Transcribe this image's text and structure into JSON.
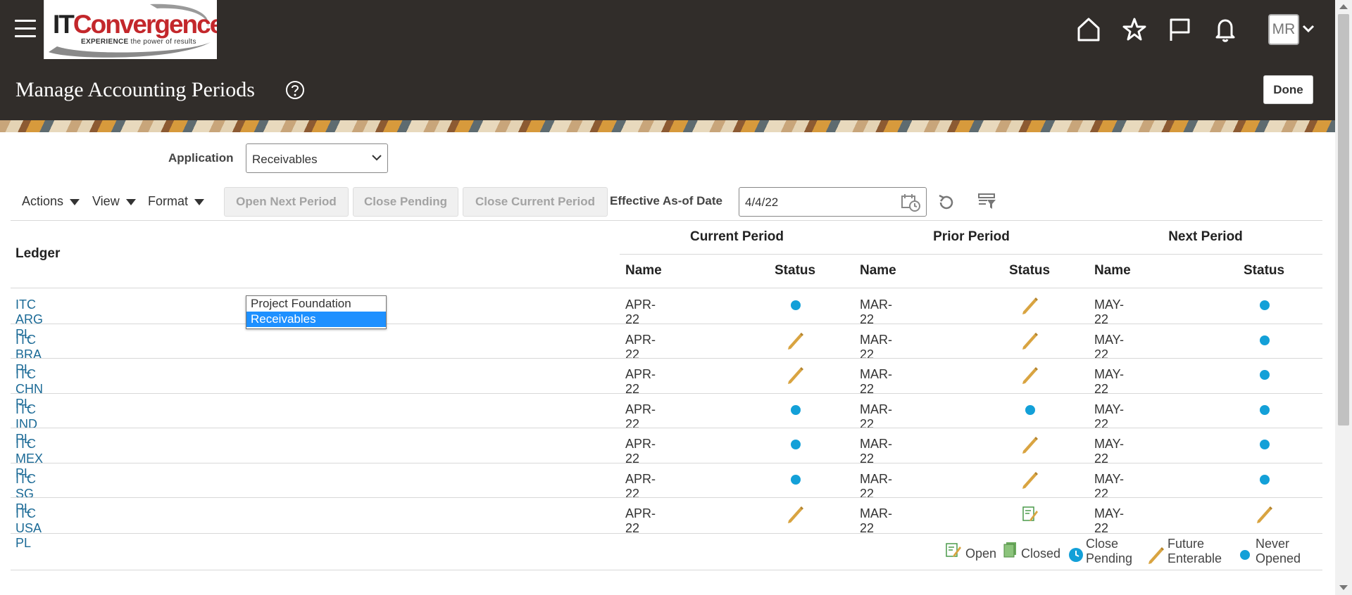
{
  "header": {
    "logo_main_it": "IT",
    "logo_main_conv": "Convergence",
    "logo_sub_bold": "EXPERIENCE",
    "logo_sub_rest": " the power of results",
    "avatar_initials": "MR",
    "icons": [
      "home-icon",
      "star-icon",
      "flag-icon",
      "bell-icon"
    ]
  },
  "page": {
    "title": "Manage Accounting Periods",
    "done_label": "Done"
  },
  "filters": {
    "application_label": "Application",
    "application_value": "Receivables",
    "application_options": [
      "Project Foundation",
      "Receivables"
    ]
  },
  "toolbar": {
    "actions_label": "Actions",
    "view_label": "View",
    "format_label": "Format",
    "open_next_period": "Open Next Period",
    "close_pending": "Close Pending",
    "close_current_period": "Close Current Period",
    "effective_date_label": "Effective As-of Date",
    "effective_date_value": "4/4/22"
  },
  "table": {
    "ledger_header": "Ledger",
    "groups": [
      "Current Period",
      "Prior Period",
      "Next Period"
    ],
    "name_header": "Name",
    "status_header": "Status",
    "rows": [
      {
        "ledger": "ITC ARG PL",
        "current_name": "APR-22",
        "current_status": "never_opened",
        "prior_name": "MAR-22",
        "prior_status": "future_enterable",
        "next_name": "MAY-22",
        "next_status": "never_opened"
      },
      {
        "ledger": "ITC BRA PL",
        "current_name": "APR-22",
        "current_status": "future_enterable",
        "prior_name": "MAR-22",
        "prior_status": "future_enterable",
        "next_name": "MAY-22",
        "next_status": "never_opened"
      },
      {
        "ledger": "ITC CHN PL",
        "current_name": "APR-22",
        "current_status": "future_enterable",
        "prior_name": "MAR-22",
        "prior_status": "future_enterable",
        "next_name": "MAY-22",
        "next_status": "never_opened"
      },
      {
        "ledger": "ITC IND PL",
        "current_name": "APR-22",
        "current_status": "never_opened",
        "prior_name": "MAR-22",
        "prior_status": "never_opened",
        "next_name": "MAY-22",
        "next_status": "never_opened"
      },
      {
        "ledger": "ITC MEX PL",
        "current_name": "APR-22",
        "current_status": "never_opened",
        "prior_name": "MAR-22",
        "prior_status": "future_enterable",
        "next_name": "MAY-22",
        "next_status": "never_opened"
      },
      {
        "ledger": "ITC SG PL",
        "current_name": "APR-22",
        "current_status": "never_opened",
        "prior_name": "MAR-22",
        "prior_status": "future_enterable",
        "next_name": "MAY-22",
        "next_status": "never_opened"
      },
      {
        "ledger": "ITC USA PL",
        "current_name": "APR-22",
        "current_status": "future_enterable",
        "prior_name": "MAR-22",
        "prior_status": "open",
        "next_name": "MAY-22",
        "next_status": "future_enterable"
      }
    ]
  },
  "legend": {
    "open": "Open",
    "closed": "Closed",
    "close_pending_1": "Close",
    "close_pending_2": "Pending",
    "future_enterable_1": "Future",
    "future_enterable_2": "Enterable",
    "never_opened_1": "Never",
    "never_opened_2": "Opened"
  },
  "colors": {
    "header_bg": "#312d2a",
    "link": "#1b6a96",
    "never_opened_dot": "#13a0d8",
    "pencil": "#d9a441",
    "selected_option": "#1e90ff"
  }
}
